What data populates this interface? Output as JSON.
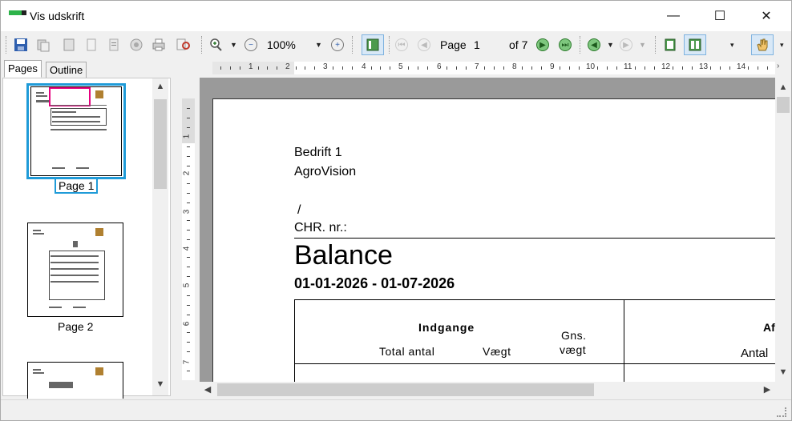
{
  "window": {
    "title": "Vis udskrift",
    "minimize": "—",
    "maximize": "☐",
    "close": "✕"
  },
  "toolbar": {
    "zoom_value": "100%",
    "page_label": "Page",
    "page_value": "1",
    "page_of": "of 7",
    "items": [
      "save-icon",
      "copy-icon",
      "page-setup-icon",
      "open-icon",
      "export-icon",
      "stop-icon",
      "print-icon",
      "preview-icon",
      "zoom-in-icon",
      "zoom-out-icon",
      "zoom-plus-icon",
      "thumbnails-icon",
      "first-page-icon",
      "prev-page-icon",
      "next-page-icon",
      "last-page-icon",
      "back-icon",
      "forward-icon",
      "single-page-icon",
      "multi-page-icon",
      "hand-tool-icon"
    ]
  },
  "tabs": {
    "pages": "Pages",
    "outline": "Outline"
  },
  "thumbnails": [
    {
      "label": "Page 1",
      "selected": true
    },
    {
      "label": "Page 2",
      "selected": false
    }
  ],
  "ruler": {
    "h_numbers": [
      "1",
      "2",
      "3",
      "4",
      "5",
      "6",
      "7",
      "8",
      "9",
      "10",
      "11",
      "12",
      "13",
      "14"
    ],
    "v_numbers": [
      "1",
      "2",
      "3",
      "4",
      "5",
      "6",
      "7"
    ]
  },
  "document": {
    "company": "Bedrift 1",
    "brand": "AgroVision",
    "slash": "/",
    "chr": "CHR. nr.:",
    "title": "Balance",
    "date_range": "01-01-2026 - 01-07-2026",
    "table": {
      "group_in": "Indgange",
      "col_total": "Total antal",
      "col_weight": "Vægt",
      "col_avg_1": "Gns.",
      "col_avg_2": "vægt",
      "group_out": "Af",
      "col_out_count": "Antal"
    }
  },
  "colors": {
    "selection": "#1f9bd8",
    "accent_green": "#2db34a"
  }
}
